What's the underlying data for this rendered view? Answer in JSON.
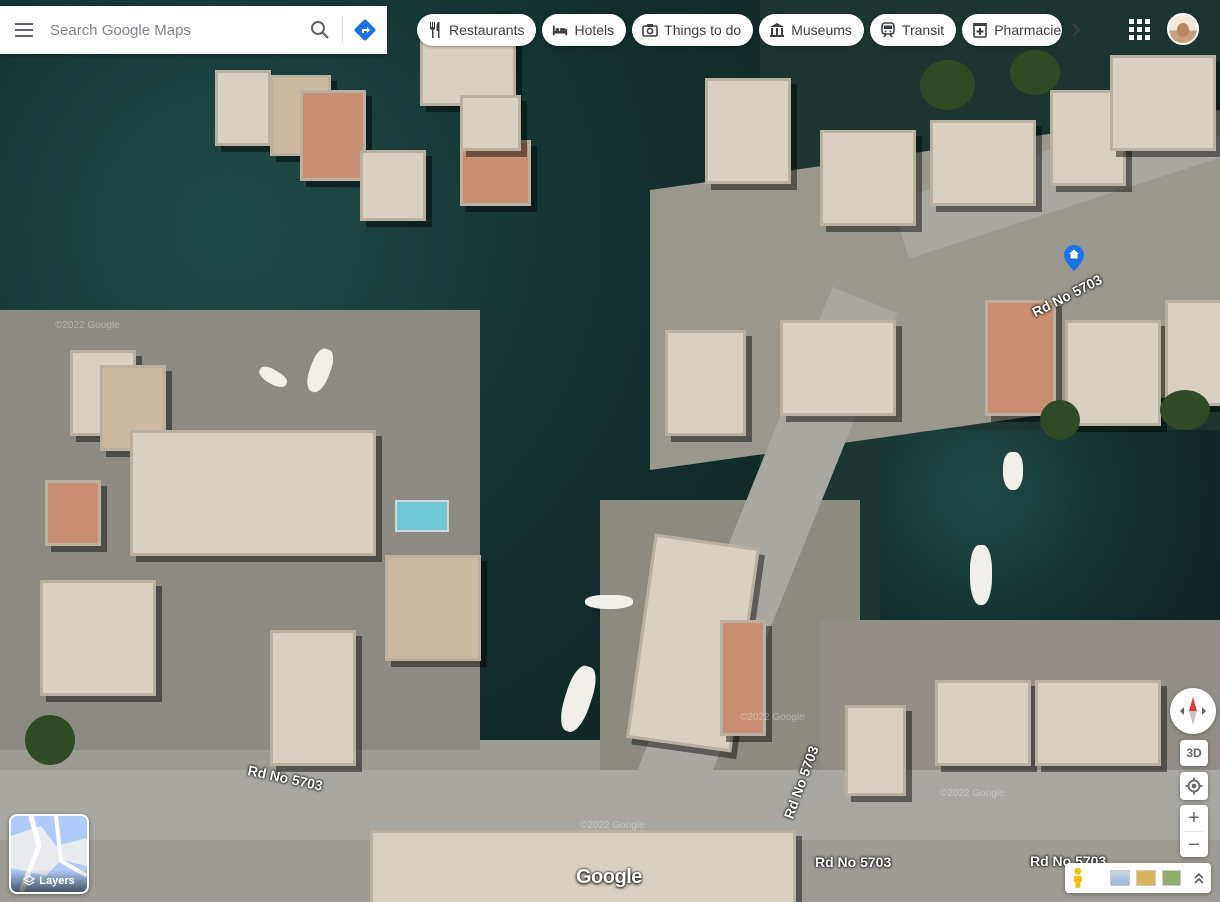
{
  "search": {
    "placeholder": "Search Google Maps"
  },
  "chips": [
    {
      "label": "Restaurants",
      "icon": "fork-knife-icon"
    },
    {
      "label": "Hotels",
      "icon": "bed-icon"
    },
    {
      "label": "Things to do",
      "icon": "camera-icon"
    },
    {
      "label": "Museums",
      "icon": "museum-icon"
    },
    {
      "label": "Transit",
      "icon": "train-icon"
    },
    {
      "label": "Pharmacies",
      "icon": "pharmacy-icon"
    }
  ],
  "roads": {
    "r1": "Rd No 5703",
    "r2": "Rd No 5703",
    "r3": "Rd No 5703",
    "r4": "Rd No 5703",
    "r5": "Rd No 5703"
  },
  "controls": {
    "btn3d": "3D",
    "zoom_in": "+",
    "zoom_out": "−"
  },
  "layers": {
    "label": "Layers"
  },
  "brand": {
    "logo": "Google"
  },
  "watermarks": [
    "©2022 Google",
    "©2022 Google",
    "©2022 Google",
    "©2022 Google"
  ],
  "colors": {
    "accent": "#1a73e8",
    "water": "#14332f"
  }
}
